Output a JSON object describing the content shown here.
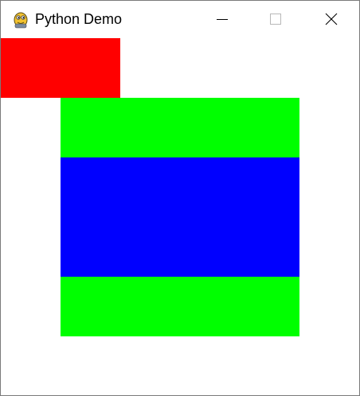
{
  "window": {
    "title": "Python Demo",
    "icon": "python-logo-icon",
    "controls": {
      "minimize_icon": "minimize-icon",
      "maximize_icon": "maximize-icon",
      "close_icon": "close-icon"
    }
  },
  "canvas": {
    "background": "#ffffff",
    "shapes": [
      {
        "name": "red-rectangle",
        "color": "#ff0000"
      },
      {
        "name": "green-square",
        "color": "#00ff00"
      },
      {
        "name": "blue-rectangle",
        "color": "#0000ff"
      }
    ]
  }
}
